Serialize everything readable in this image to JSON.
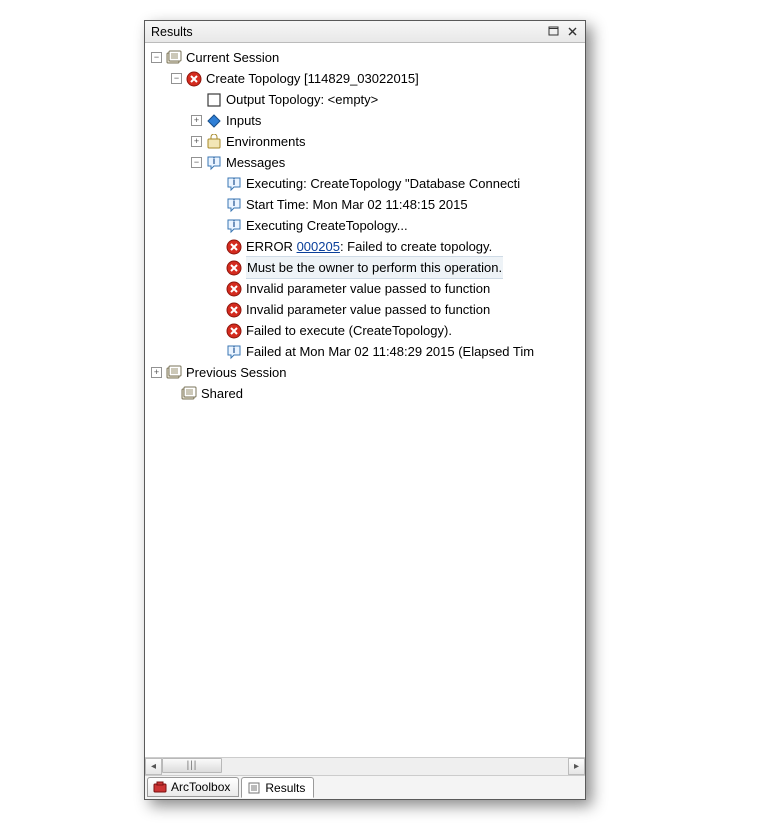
{
  "window": {
    "title": "Results"
  },
  "tree": {
    "currentSession": {
      "label": "Current Session",
      "createTopology": {
        "label": "Create Topology [114829_03022015]",
        "outputTopology": {
          "label": "Output Topology: <empty>"
        },
        "inputs": {
          "label": "Inputs"
        },
        "environments": {
          "label": "Environments"
        },
        "messages": {
          "label": "Messages",
          "items": [
            {
              "kind": "info",
              "text": "Executing: CreateTopology \"Database Connecti"
            },
            {
              "kind": "info",
              "text": "Start Time: Mon Mar 02 11:48:15 2015"
            },
            {
              "kind": "info",
              "text": "Executing CreateTopology..."
            },
            {
              "kind": "error",
              "pre": "ERROR ",
              "code": "000205",
              "post": ": Failed to create topology."
            },
            {
              "kind": "error",
              "text": "Must be the owner to perform this operation.",
              "highlight": true
            },
            {
              "kind": "error",
              "text": "Invalid parameter value passed to function"
            },
            {
              "kind": "error",
              "text": "Invalid parameter value passed to function"
            },
            {
              "kind": "error",
              "text": "Failed to execute (CreateTopology)."
            },
            {
              "kind": "info",
              "text": "Failed at Mon Mar 02 11:48:29 2015 (Elapsed Tim"
            }
          ]
        }
      }
    },
    "previousSession": {
      "label": "Previous Session"
    },
    "shared": {
      "label": "Shared"
    }
  },
  "tabs": {
    "arctoolbox": "ArcToolbox",
    "results": "Results"
  },
  "scroll": {
    "thumb_glyph": "|||"
  }
}
